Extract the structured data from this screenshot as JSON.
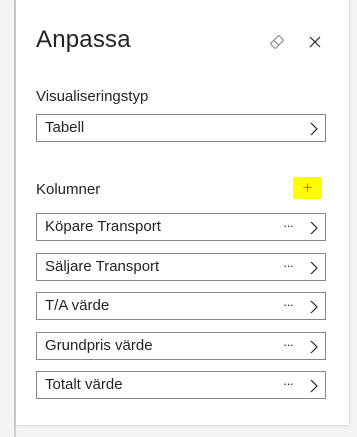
{
  "panel": {
    "title": "Anpassa",
    "icons": {
      "eraser": "eraser-icon",
      "close": "close-icon"
    }
  },
  "visualization": {
    "label": "Visualiseringstyp",
    "selected": "Tabell"
  },
  "columns": {
    "label": "Kolumner",
    "add_label": "+",
    "add_highlight_color": "#ffff00",
    "items": [
      {
        "label": "Köpare Transport",
        "more": "···"
      },
      {
        "label": "Säljare Transport",
        "more": "···"
      },
      {
        "label": "T/A värde",
        "more": "···"
      },
      {
        "label": "Grundpris värde",
        "more": "···"
      },
      {
        "label": "Totalt värde",
        "more": "···"
      }
    ]
  }
}
